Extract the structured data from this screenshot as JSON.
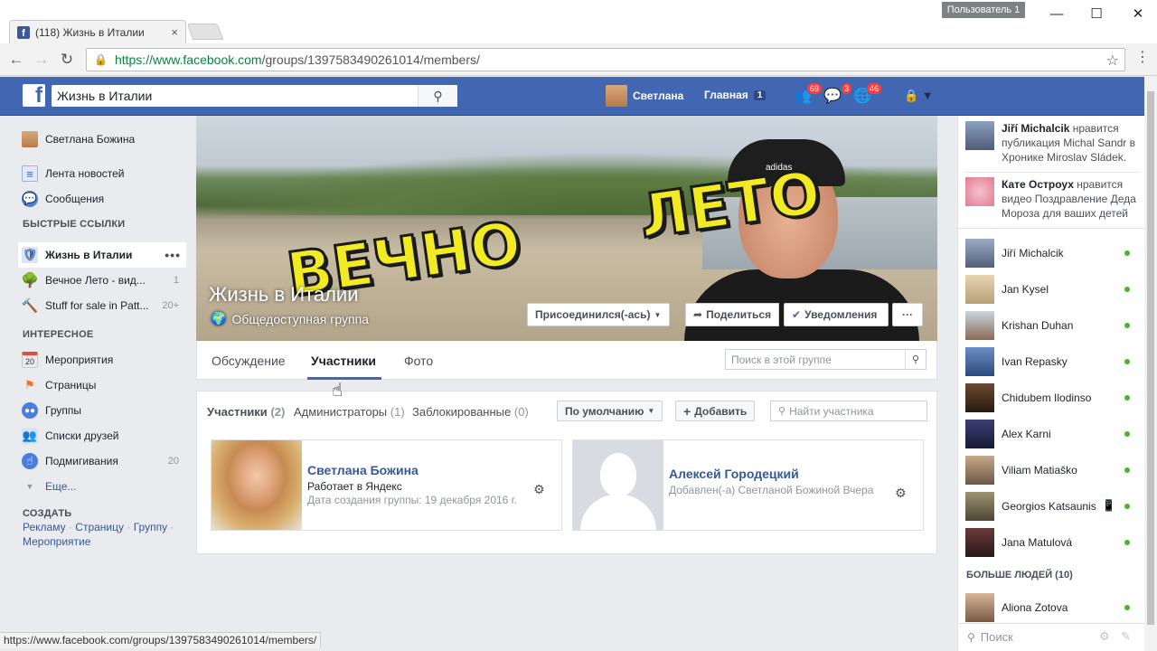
{
  "browser": {
    "tab_title": "(118) Жизнь в Италии",
    "tab_close": "×",
    "user_badge": "Пользователь 1",
    "url_scheme_host": "https://www.facebook.com",
    "url_path": "/groups/1397583490261014/members/",
    "status_url": "https://www.facebook.com/groups/1397583490261014/members/"
  },
  "topbar": {
    "search_value": "Жизнь в Италии",
    "user_name": "Светлана",
    "home_label": "Главная",
    "home_count": "1",
    "friend_requests_count": "69",
    "messages_count": "3",
    "notifications_count": "46"
  },
  "leftnav": {
    "profile_name": "Светлана Божина",
    "news_feed": "Лента новостей",
    "messages": "Сообщения",
    "shortcuts_heading": "БЫСТРЫЕ ССЫЛКИ",
    "shortcuts": [
      {
        "label": "Жизнь в Италии",
        "count": ""
      },
      {
        "label": "Вечное Лето - вид...",
        "count": "1"
      },
      {
        "label": "Stuff for sale in Patt...",
        "count": "20+"
      }
    ],
    "explore_heading": "ИНТЕРЕСНОЕ",
    "explore": [
      {
        "label": "Мероприятия",
        "count": ""
      },
      {
        "label": "Страницы",
        "count": ""
      },
      {
        "label": "Группы",
        "count": ""
      },
      {
        "label": "Списки друзей",
        "count": ""
      },
      {
        "label": "Подмигивания",
        "count": "20"
      }
    ],
    "more": "Еще...",
    "create_heading": "СОЗДАТЬ",
    "create_links": [
      "Рекламу",
      "Страницу",
      "Группу",
      "Мероприятие"
    ],
    "sep": "·",
    "calendar_day": "20"
  },
  "cover": {
    "group_name": "Жизнь в Италии",
    "privacy": "Общедоступная группа",
    "overlay_word_1": "ВЕЧНО",
    "overlay_word_2": "ЛЕТО",
    "cap_brand": "adidas",
    "joined_button": "Присоединился(-ась)",
    "share_button": "Поделиться",
    "notifications_button": "Уведомления",
    "more_button": "···"
  },
  "group_tabs": {
    "discussion": "Обсуждение",
    "members": "Участники",
    "photos": "Фото",
    "search_placeholder": "Поиск в этой группе"
  },
  "members": {
    "tab_members": "Участники",
    "tab_members_count": "(2)",
    "tab_admins": "Администраторы",
    "tab_admins_count": "(1)",
    "tab_blocked": "Заблокированные",
    "tab_blocked_count": "(0)",
    "sort_button": "По умолчанию",
    "add_button": "Добавить",
    "search_placeholder": "Найти участника",
    "cards": [
      {
        "name": "Светлана Божина",
        "line1": "Работает в Яндекс",
        "line2": "Дата создания группы: 19 декабря 2016 г."
      },
      {
        "name": "Алексей Городецкий",
        "line1": "Добавлен(-а) Светланой Божиной Вчера",
        "line2": ""
      }
    ]
  },
  "ticker": [
    {
      "actor": "Jiří Michalcik",
      "text": " нравится публикация Michal Sandr в Хронике Miroslav Sládek."
    },
    {
      "actor": "Кате Остроух",
      "text": " нравится видео Поздравление Деда Мороза для ваших детей"
    }
  ],
  "chat": {
    "contacts": [
      "Jiří Michalcik",
      "Jan Kysel",
      "Krishan Duhan",
      "Ivan Repasky",
      "Chidubem Ilodinso",
      "Alex Karni",
      "Viliam Matiaško",
      "Georgios Katsaunis",
      "Jana Matulová"
    ],
    "more_people": "БОЛЬШЕ ЛЮДЕЙ (10)",
    "extra_contact": "Aliona Zotova",
    "search_placeholder": "Поиск"
  },
  "colors": {
    "fb_blue": "#4267b2",
    "link_blue": "#365899",
    "online_green": "#42b72a",
    "badge_red": "#fa3e3e",
    "cover_text_yellow": "#f2ea22"
  }
}
